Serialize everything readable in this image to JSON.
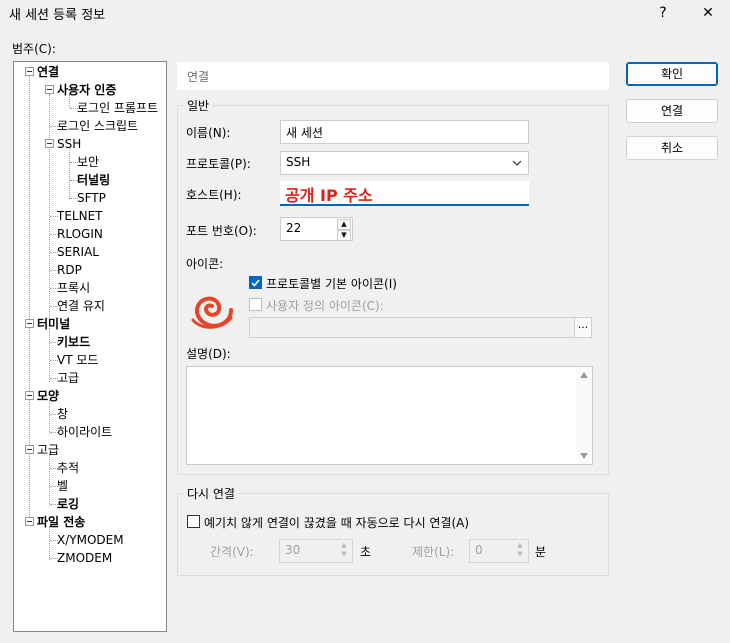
{
  "window": {
    "title": "새 세션 등록 정보",
    "help": "?",
    "close": "✕"
  },
  "category_label": "범주(C):",
  "tree": {
    "connection": "연결",
    "auth": "사용자 인증",
    "login_prompt": "로그인 프롬프트",
    "login_script": "로그인 스크립트",
    "ssh": "SSH",
    "security": "보안",
    "tunneling": "터널링",
    "sftp": "SFTP",
    "telnet": "TELNET",
    "rlogin": "RLOGIN",
    "serial": "SERIAL",
    "rdp": "RDP",
    "proxy": "프록시",
    "keepalive": "연결 유지",
    "terminal": "터미널",
    "keyboard": "키보드",
    "vt_mode": "VT 모드",
    "advanced": "고급",
    "appearance": "모양",
    "window": "창",
    "highlight": "하이라이트",
    "advanced2": "고급",
    "trace": "추적",
    "bell": "벨",
    "logging": "로깅",
    "file_transfer": "파일 전송",
    "xymodem": "X/YMODEM",
    "zmodem": "ZMODEM"
  },
  "breadcrumb": "연결",
  "general": {
    "group_label": "일반",
    "name_label": "이름(N):",
    "name_value": "새 세션",
    "protocol_label": "프로토콜(P):",
    "protocol_value": "SSH",
    "host_label": "호스트(H):",
    "host_value": "공개 IP 주소",
    "port_label": "포트 번호(O):",
    "port_value": "22",
    "icon_label": "아이콘:",
    "default_icon_label": "프로토콜별 기본 아이콘(I)",
    "default_icon_checked": true,
    "custom_icon_label": "사용자 정의 아이콘(C):",
    "custom_icon_checked": false,
    "browse": "...",
    "desc_label": "설명(D):"
  },
  "reconnect": {
    "group_label": "다시 연결",
    "auto_label": "예기치 않게 연결이 끊겼을 때 자동으로 다시 연결(A)",
    "interval_label": "간격(V):",
    "interval_value": "30",
    "interval_unit": "초",
    "limit_label": "제한(L):",
    "limit_value": "0",
    "limit_unit": "분"
  },
  "buttons": {
    "ok": "확인",
    "connect": "연결",
    "cancel": "취소"
  },
  "colors": {
    "accent": "#0067c0",
    "host_text": "#e0201b"
  }
}
